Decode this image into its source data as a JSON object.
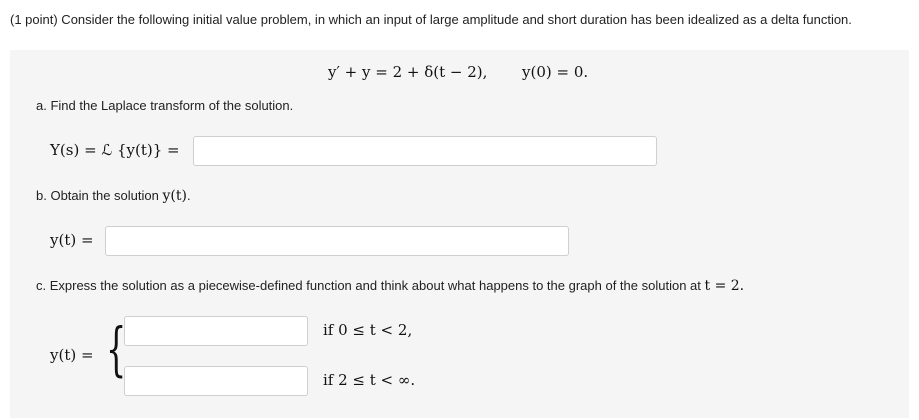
{
  "problem": {
    "intro": "(1 point) Consider the following initial value problem, in which an input of large amplitude and short duration has been idealized as a delta function."
  },
  "equation": {
    "lhs": "y′ + y = 2 + δ(t − 2),",
    "initial": "y(0) = 0."
  },
  "part_a": {
    "prompt": "a. Find the Laplace transform of the solution.",
    "label": "Y(s) = ℒ {y(t)} =",
    "answer": ""
  },
  "part_b": {
    "prompt_prefix": "b. Obtain the solution",
    "prompt_math": "y(t)",
    "prompt_suffix": ".",
    "label": "y(t) =",
    "answer": ""
  },
  "part_c": {
    "prompt_prefix": "c. Express the solution as a piecewise-defined function and think about what happens to the graph of the solution at",
    "prompt_math": "t = 2.",
    "label": "y(t) =",
    "brace": "{",
    "piece1_answer": "",
    "piece1_cond": "if 0 ≤ t < 2,",
    "piece2_answer": "",
    "piece2_cond": "if 2 ≤ t < ∞."
  }
}
